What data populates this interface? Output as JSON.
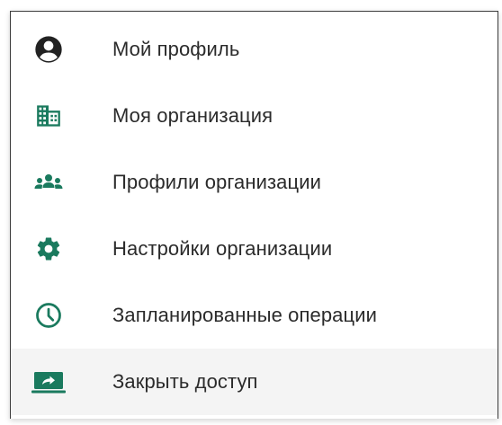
{
  "colors": {
    "icon_dark": "#222222",
    "icon_accent": "#1a7a5e",
    "text": "#2b2b2b",
    "active_bg": "#f4f4f4"
  },
  "menu": {
    "items": [
      {
        "label": "Мой профиль",
        "icon": "account-circle-icon"
      },
      {
        "label": "Моя организация",
        "icon": "building-icon"
      },
      {
        "label": "Профили организации",
        "icon": "people-group-icon"
      },
      {
        "label": "Настройки организации",
        "icon": "gear-icon"
      },
      {
        "label": "Запланированные операции",
        "icon": "clock-icon"
      },
      {
        "label": "Закрыть доступ",
        "icon": "screen-share-icon",
        "active": true
      }
    ]
  }
}
